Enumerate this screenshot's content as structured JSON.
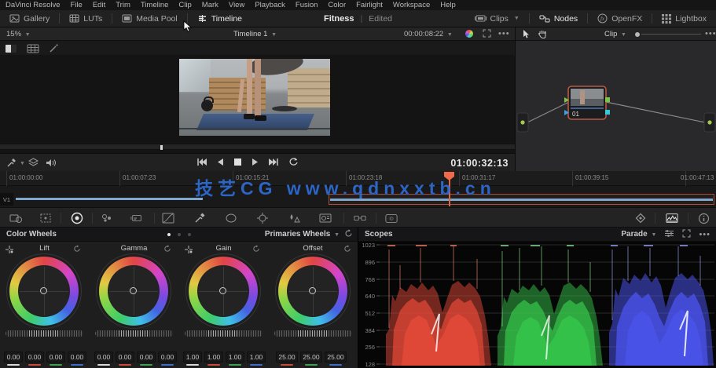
{
  "menu_bar": {
    "items": [
      "DaVinci Resolve",
      "File",
      "Edit",
      "Trim",
      "Timeline",
      "Clip",
      "Mark",
      "View",
      "Playback",
      "Fusion",
      "Color",
      "Fairlight",
      "Workspace",
      "Help"
    ]
  },
  "top_bar": {
    "gallery_label": "Gallery",
    "luts_label": "LUTs",
    "media_pool_label": "Media Pool",
    "timeline_label": "Timeline",
    "project_title": "Fitness",
    "project_status": "Edited",
    "clips_label": "Clips",
    "nodes_label": "Nodes",
    "openfx_label": "OpenFX",
    "lightbox_label": "Lightbox"
  },
  "viewer": {
    "zoom_level": "15%",
    "timeline_name": "Timeline 1",
    "clip_timecode": "00:00:08:22",
    "playhead_timecode": "01:00:32:13",
    "menu_ellipsis": "•••"
  },
  "node_panel": {
    "mode_label": "Clip",
    "node_label": "01",
    "menu_ellipsis": "•••"
  },
  "timeline": {
    "track_label": "V1",
    "ruler_labels": [
      "01:00:00:00",
      "01:00:07:23",
      "01:00:15:21",
      "01:00:23:18",
      "01:00:31:17",
      "01:00:39:15",
      "01:00:47:13"
    ]
  },
  "watermark": {
    "text": "技艺CG www.qdnxxtb.cn",
    "color": "#2e6ad0"
  },
  "color_wheels": {
    "panel_title": "Color Wheels",
    "mode_label": "Primaries Wheels",
    "wheels": [
      {
        "name": "Lift",
        "values": [
          "0.00",
          "0.00",
          "0.00",
          "0.00"
        ]
      },
      {
        "name": "Gamma",
        "values": [
          "0.00",
          "0.00",
          "0.00",
          "0.00"
        ]
      },
      {
        "name": "Gain",
        "values": [
          "1.00",
          "1.00",
          "1.00",
          "1.00"
        ]
      },
      {
        "name": "Offset",
        "values": [
          "25.00",
          "25.00",
          "25.00"
        ]
      }
    ],
    "channel_underline_colors": [
      "#d8d8d8",
      "#c84c3c",
      "#3fa054",
      "#3f6ec8"
    ],
    "offset_underline_colors": [
      "#c84c3c",
      "#3fa054",
      "#3f6ec8"
    ]
  },
  "scopes": {
    "panel_title": "Scopes",
    "mode_label": "Parade",
    "menu_ellipsis": "•••",
    "axis_labels": [
      "1023",
      "896",
      "768",
      "640",
      "512",
      "384",
      "256",
      "128"
    ],
    "channel_colors": {
      "red": "#e04838",
      "green": "#35c24a",
      "blue": "#4a52e8"
    }
  },
  "colors": {
    "playhead_orange": "#ee6a4a",
    "clip_selected_border": "#a8503c",
    "timeline_bar_blue": "#7fa8cc",
    "node_selected_border": "#b35a45"
  }
}
